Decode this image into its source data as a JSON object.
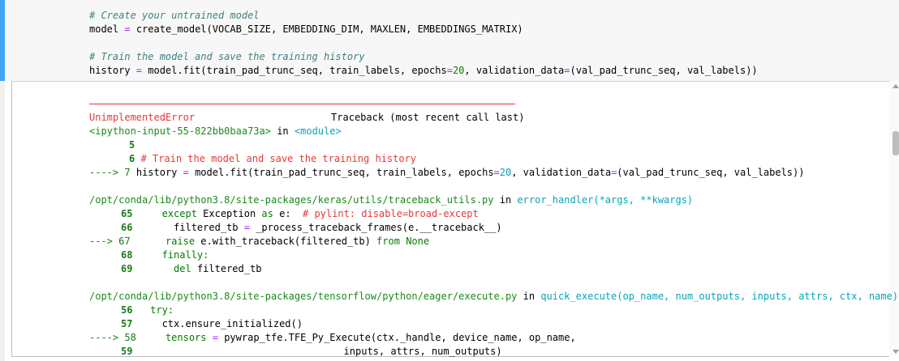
{
  "input": {
    "lines": [
      "# Create your untrained model",
      "model = create_model(VOCAB_SIZE, EMBEDDING_DIM, MAXLEN, EMBEDDINGS_MATRIX)",
      "",
      "# Train the model and save the training history",
      "history = model.fit(train_pad_trunc_seq, train_labels, epochs=20, validation_data=(val_pad_trunc_seq, val_labels))"
    ]
  },
  "traceback": {
    "error_name": "UnimplementedError",
    "header_right": "Traceback (most recent call last)",
    "frame1": {
      "location": "<ipython-input-55-822bb0baa73a>",
      "in": "in",
      "func": "<module>",
      "l5": "5",
      "l6_no": "6",
      "l6_code": "# Train the model and save the training history",
      "l7_arrow": "---->",
      "l7_no": "7",
      "l7_code": "history = model.fit(train_pad_trunc_seq, train_labels, epochs=20, validation_data=(val_pad_trunc_seq, val_labels))"
    },
    "frame2": {
      "path": "/opt/conda/lib/python3.8/site-packages/keras/utils/traceback_utils.py",
      "in": "in",
      "func": "error_handler(*args, **kwargs)",
      "lines": [
        {
          "no": "65",
          "code": "except Exception as e:  # pylint: disable=broad-except"
        },
        {
          "no": "66",
          "code": "  filtered_tb = _process_traceback_frames(e.__traceback__)"
        },
        {
          "no": "67",
          "code": " raise e.with_traceback(filtered_tb) from None",
          "arrow": "--->"
        },
        {
          "no": "68",
          "code": "finally:"
        },
        {
          "no": "69",
          "code": "  del filtered_tb"
        }
      ]
    },
    "frame3": {
      "path": "/opt/conda/lib/python3.8/site-packages/tensorflow/python/eager/execute.py",
      "in": "in",
      "func": "quick_execute(op_name, num_outputs, inputs, attrs, ctx, name)",
      "lines": [
        {
          "no": "56",
          "code": "try:"
        },
        {
          "no": "57",
          "code": "  ctx.ensure_initialized()"
        },
        {
          "no": "58",
          "code": "tensors = pywrap_tfe.TFE_Py_Execute(ctx._handle, device_name, op_name,",
          "arrow": "---->"
        },
        {
          "no": "59",
          "code": "                                    inputs, attrs, num_outputs)"
        }
      ]
    }
  }
}
